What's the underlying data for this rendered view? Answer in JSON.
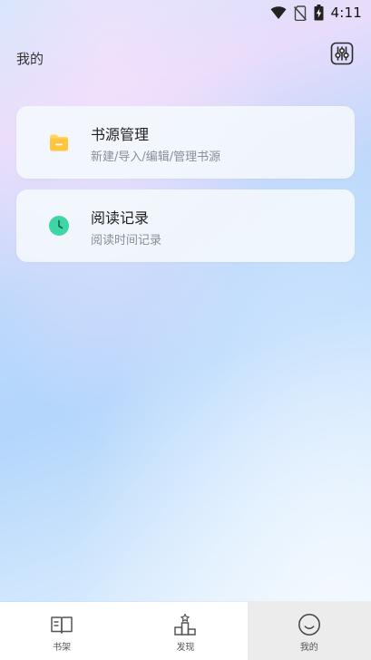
{
  "status_bar": {
    "time": "4:11",
    "icons": [
      "wifi-icon",
      "no-sim-icon",
      "battery-charging-icon"
    ]
  },
  "header": {
    "title": "我的",
    "settings_icon": "sliders-icon"
  },
  "menu": {
    "items": [
      {
        "title": "书源管理",
        "subtitle": "新建/导入/编辑/管理书源",
        "icon": "folder-icon",
        "icon_color": "#ffc53d"
      },
      {
        "title": "阅读记录",
        "subtitle": "阅读时间记录",
        "icon": "clock-icon",
        "icon_color": "#3ed6a5"
      }
    ]
  },
  "bottom_nav": {
    "items": [
      {
        "label": "书架",
        "icon": "book-icon",
        "active": false
      },
      {
        "label": "发现",
        "icon": "podium-icon",
        "active": false
      },
      {
        "label": "我的",
        "icon": "smile-icon",
        "active": true
      }
    ]
  }
}
